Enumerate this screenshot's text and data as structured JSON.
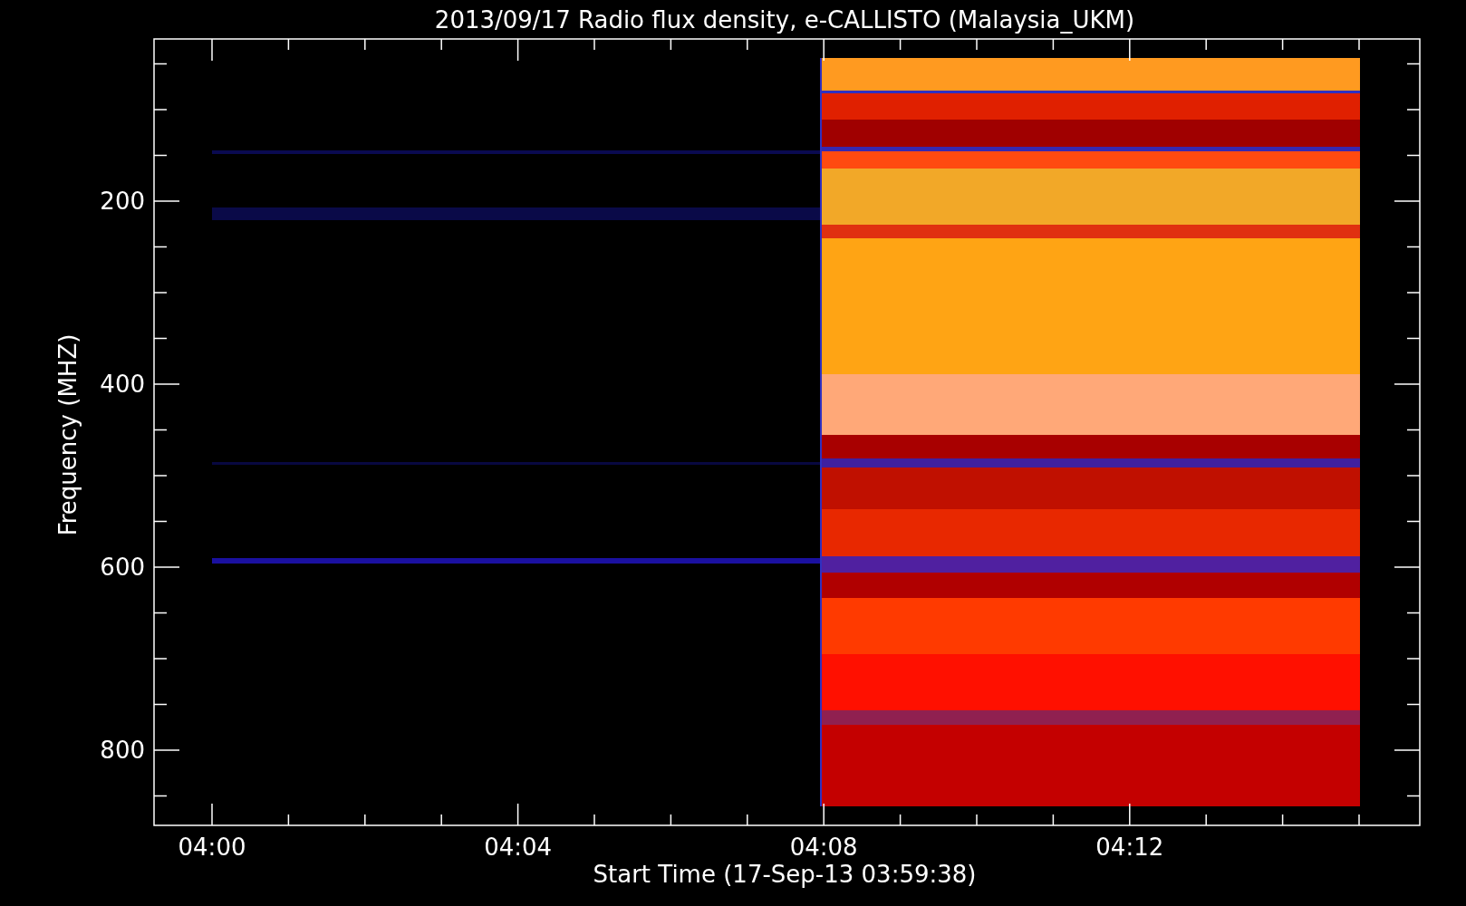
{
  "title": "2013/09/17  Radio flux density, e-CALLISTO (Malaysia_UKM)",
  "y_axis": {
    "label": "Frequency (MHZ)",
    "tick_labels": [
      "200",
      "400",
      "600",
      "800"
    ]
  },
  "x_axis": {
    "label": "Start Time (17-Sep-13 03:59:38)",
    "tick_labels": [
      "04:00",
      "04:04",
      "04:08",
      "04:12"
    ]
  }
}
